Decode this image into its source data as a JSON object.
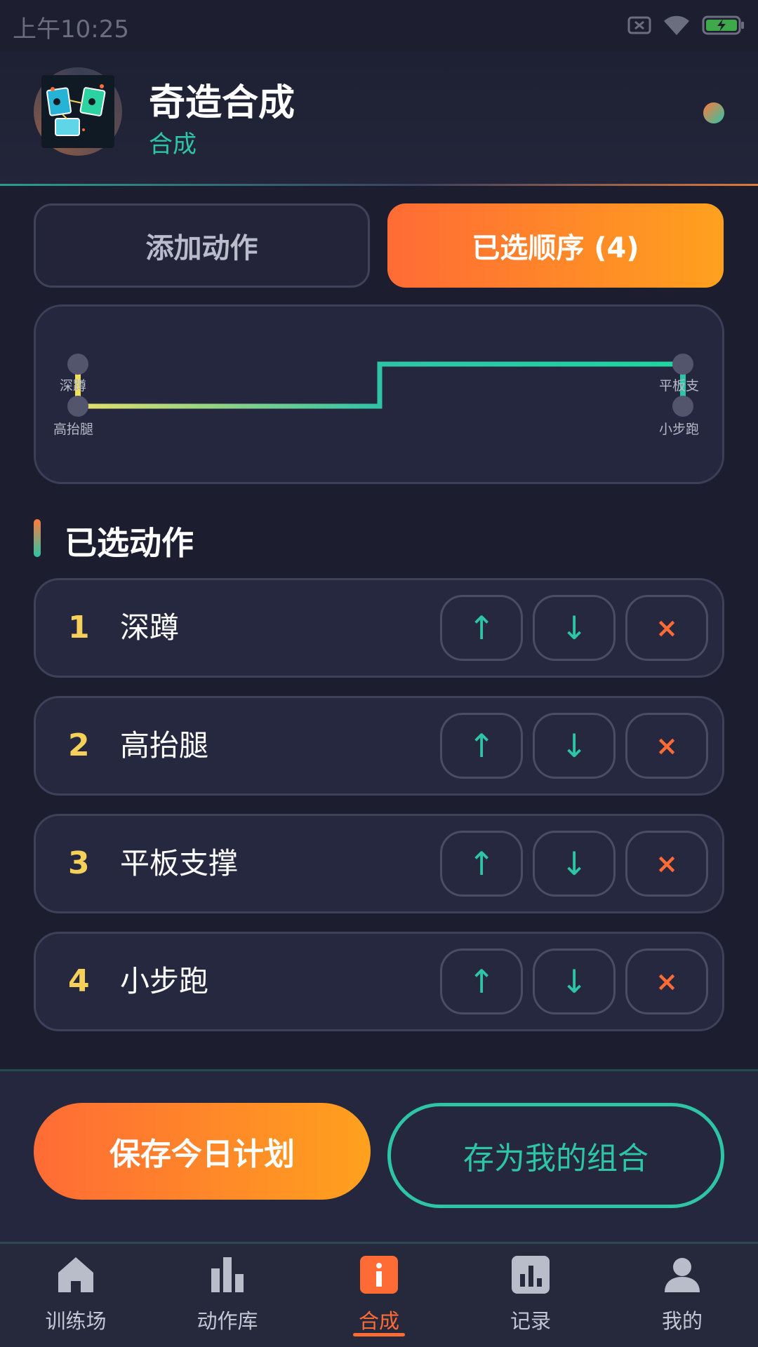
{
  "status_bar": {
    "time": "上午10:25"
  },
  "header": {
    "title": "奇造合成",
    "subtitle": "合成"
  },
  "tabs": [
    {
      "label": "添加动作"
    },
    {
      "label": "已选顺序 (4)"
    }
  ],
  "sequence_map": {
    "nodes": [
      {
        "label": "深蹲"
      },
      {
        "label": "高抬腿"
      },
      {
        "label": "平板支"
      },
      {
        "label": "小步跑"
      }
    ]
  },
  "section": {
    "title": "已选动作"
  },
  "rows": [
    {
      "num": "1",
      "name": "深蹲",
      "up": "↑",
      "down": "↓",
      "remove": "×"
    },
    {
      "num": "2",
      "name": "高抬腿",
      "up": "↑",
      "down": "↓",
      "remove": "×"
    },
    {
      "num": "3",
      "name": "平板支撑",
      "up": "↑",
      "down": "↓",
      "remove": "×"
    },
    {
      "num": "4",
      "name": "小步跑",
      "up": "↑",
      "down": "↓",
      "remove": "×"
    }
  ],
  "actions": {
    "save": "保存今日计划",
    "save_combo": "存为我的组合"
  },
  "nav": {
    "items": [
      {
        "label": "训练场",
        "icon": "home-icon"
      },
      {
        "label": "动作库",
        "icon": "bar-chart-icon"
      },
      {
        "label": "合成",
        "icon": "info-icon"
      },
      {
        "label": "记录",
        "icon": "stats-icon"
      },
      {
        "label": "我的",
        "icon": "user-icon"
      }
    ],
    "active_index": 2
  },
  "colors": {
    "accent_orange": "#ff6b35",
    "accent_teal": "#2ec4a6",
    "number_yellow": "#f5d15a"
  }
}
